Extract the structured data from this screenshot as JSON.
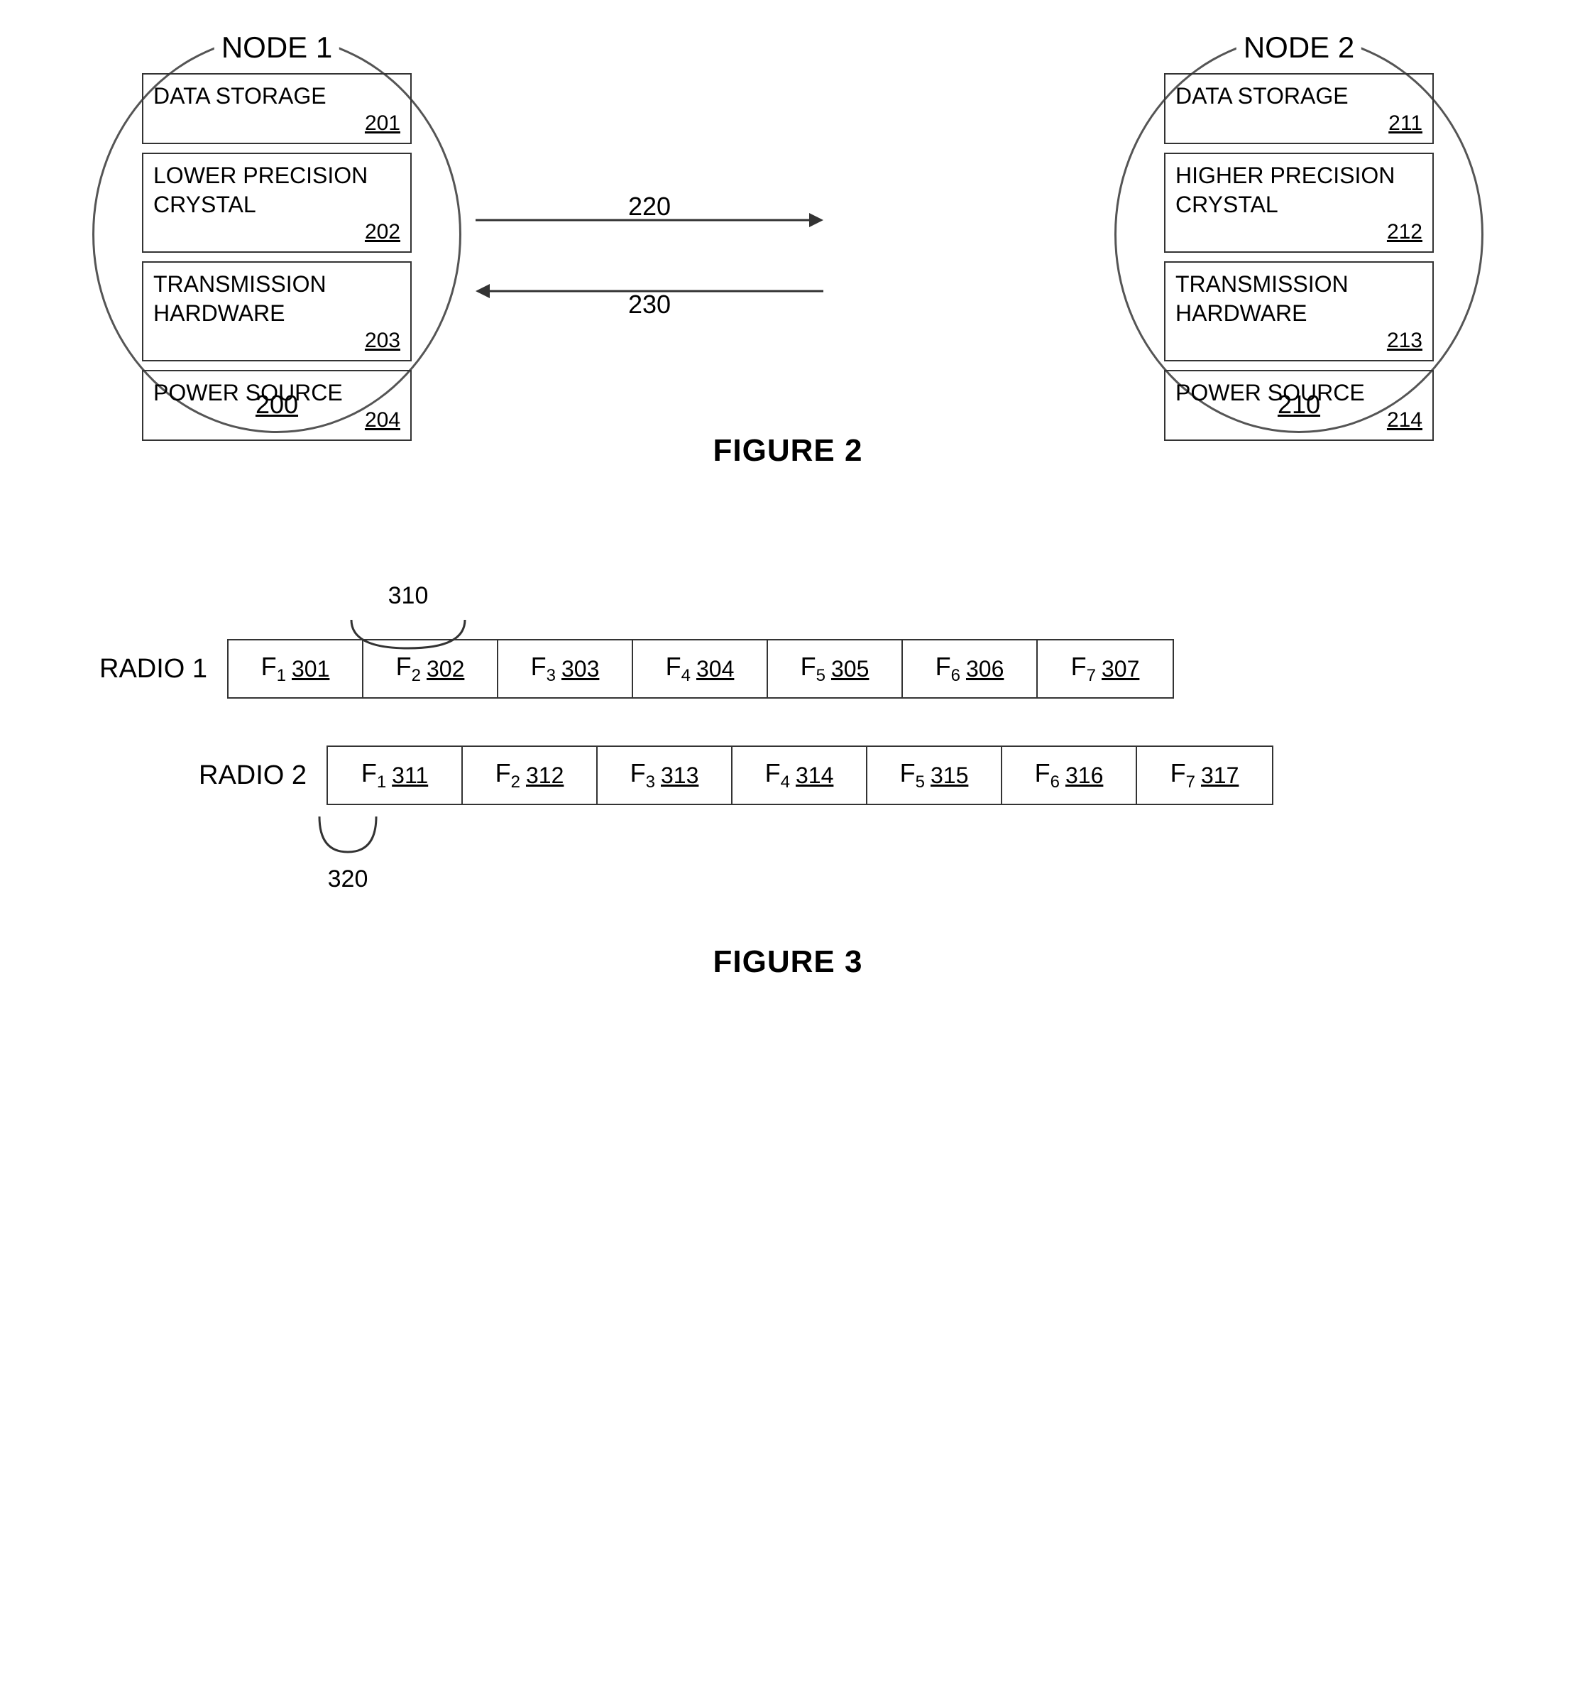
{
  "figure2": {
    "title": "FIGURE 2",
    "node1": {
      "label": "NODE 1",
      "ref": "200",
      "boxes": [
        {
          "text": "DATA STORAGE",
          "ref": "201"
        },
        {
          "text": "LOWER PRECISION\nCRYSTAL",
          "ref": "202"
        },
        {
          "text": "TRANSMISSION\nHARDWARE",
          "ref": "203"
        },
        {
          "text": "POWER SOURCE",
          "ref": "204"
        }
      ]
    },
    "node2": {
      "label": "NODE 2",
      "ref": "210",
      "boxes": [
        {
          "text": "DATA STORAGE",
          "ref": "211"
        },
        {
          "text": "HIGHER PRECISION\nCRYSTAL",
          "ref": "212"
        },
        {
          "text": "TRANSMISSION\nHARDWARE",
          "ref": "213"
        },
        {
          "text": "POWER SOURCE",
          "ref": "214"
        }
      ]
    },
    "arrow1_label": "220",
    "arrow2_label": "230"
  },
  "figure3": {
    "title": "FIGURE 3",
    "radio1": {
      "label": "RADIO 1",
      "cells": [
        {
          "name": "F",
          "sub": "1",
          "ref": "301"
        },
        {
          "name": "F",
          "sub": "2",
          "ref": "302"
        },
        {
          "name": "F",
          "sub": "3",
          "ref": "303"
        },
        {
          "name": "F",
          "sub": "4",
          "ref": "304"
        },
        {
          "name": "F",
          "sub": "5",
          "ref": "305"
        },
        {
          "name": "F",
          "sub": "6",
          "ref": "306"
        },
        {
          "name": "F",
          "sub": "7",
          "ref": "307"
        }
      ]
    },
    "radio2": {
      "label": "RADIO 2",
      "cells": [
        {
          "name": "F",
          "sub": "1",
          "ref": "311"
        },
        {
          "name": "F",
          "sub": "2",
          "ref": "312"
        },
        {
          "name": "F",
          "sub": "3",
          "ref": "313"
        },
        {
          "name": "F",
          "sub": "4",
          "ref": "314"
        },
        {
          "name": "F",
          "sub": "5",
          "ref": "315"
        },
        {
          "name": "F",
          "sub": "6",
          "ref": "316"
        },
        {
          "name": "F",
          "sub": "7",
          "ref": "317"
        }
      ]
    },
    "brace_label": "310",
    "bracket_label": "320"
  }
}
